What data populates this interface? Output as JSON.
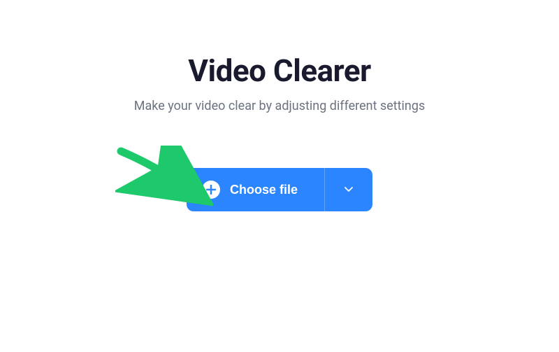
{
  "header": {
    "title": "Video Clearer",
    "subtitle": "Make your video clear by adjusting different settings"
  },
  "upload": {
    "button_label": "Choose file",
    "plus_icon": "plus-icon",
    "dropdown_icon": "chevron-down-icon"
  },
  "colors": {
    "primary": "#2b85ff",
    "text_dark": "#1a1a2e",
    "text_muted": "#6b7280",
    "annotation": "#1ec96b"
  }
}
